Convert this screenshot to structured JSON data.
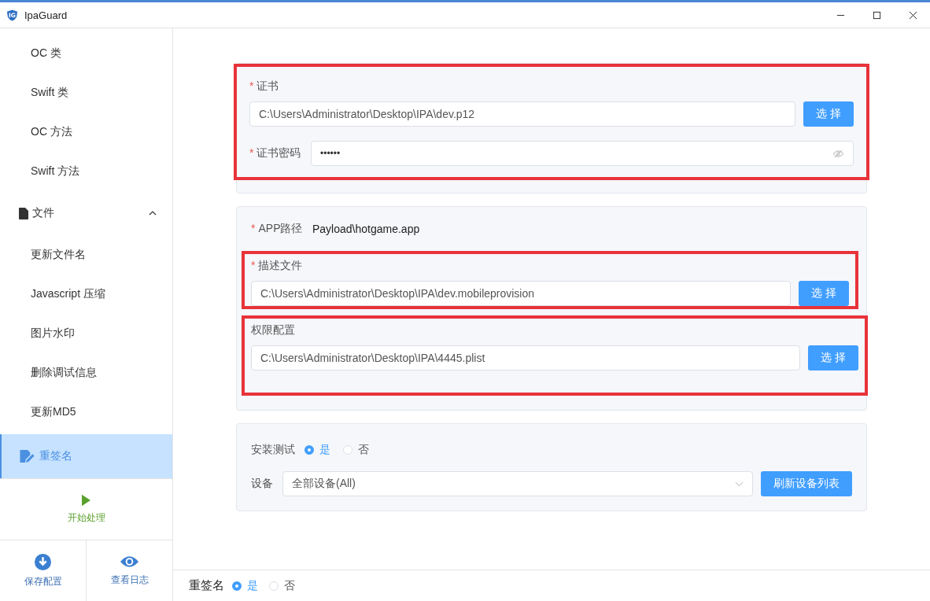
{
  "window": {
    "title": "IpaGuard",
    "logo_text": "IG"
  },
  "sidebar": {
    "items": [
      {
        "kind": "item",
        "label": "OC 类",
        "selected": false
      },
      {
        "kind": "item",
        "label": "Swift 类",
        "selected": false
      },
      {
        "kind": "item",
        "label": "OC 方法",
        "selected": false
      },
      {
        "kind": "item",
        "label": "Swift 方法",
        "selected": false
      },
      {
        "kind": "group",
        "label": "文件",
        "expanded": true,
        "children": [
          {
            "label": "更新文件名",
            "selected": false
          },
          {
            "label": "Javascript 压缩",
            "selected": false
          },
          {
            "label": "图片水印",
            "selected": false
          },
          {
            "label": "删除调试信息",
            "selected": false
          },
          {
            "label": "更新MD5",
            "selected": false
          },
          {
            "label": "重签名",
            "selected": true
          }
        ]
      }
    ],
    "start_button": "开始处理",
    "footer_buttons": [
      {
        "kind": "save",
        "label": "保存配置"
      },
      {
        "kind": "log",
        "label": "查看日志"
      }
    ]
  },
  "cards": [
    {
      "highlighted": true,
      "fields": [
        {
          "kind": "file",
          "label": "证书",
          "mark": "*",
          "value": "C:\\Users\\Administrator\\Desktop\\IPA\\dev.p12",
          "button": "选 择",
          "highlighted": false
        },
        {
          "kind": "password",
          "label": "证书密码",
          "mark": "*",
          "value": "••••••",
          "highlighted": false
        }
      ]
    },
    {
      "highlighted": false,
      "fields": [
        {
          "kind": "text",
          "label": "APP路径",
          "mark": "*",
          "value": "Payload\\hotgame.app",
          "highlighted": false
        },
        {
          "kind": "file",
          "label": "描述文件",
          "mark": "*",
          "value": "C:\\Users\\Administrator\\Desktop\\IPA\\dev.mobileprovision",
          "button": "选 择",
          "highlighted": true
        },
        {
          "kind": "file",
          "label": "权限配置",
          "value": "C:\\Users\\Administrator\\Desktop\\IPA\\4445.plist",
          "button": "选 择",
          "highlighted": true
        }
      ]
    },
    {
      "highlighted": false,
      "fields": [
        {
          "kind": "radio",
          "label": "安装测试",
          "options": [
            {
              "label": "是",
              "selected": true
            },
            {
              "label": "否",
              "selected": false
            }
          ]
        },
        {
          "kind": "select",
          "label": "设备",
          "value": "全部设备(All)",
          "button": "刷新设备列表"
        }
      ]
    }
  ],
  "bottom_bar": {
    "label": "重签名",
    "options": [
      {
        "label": "是",
        "selected": true
      },
      {
        "label": "否",
        "selected": false
      }
    ]
  }
}
